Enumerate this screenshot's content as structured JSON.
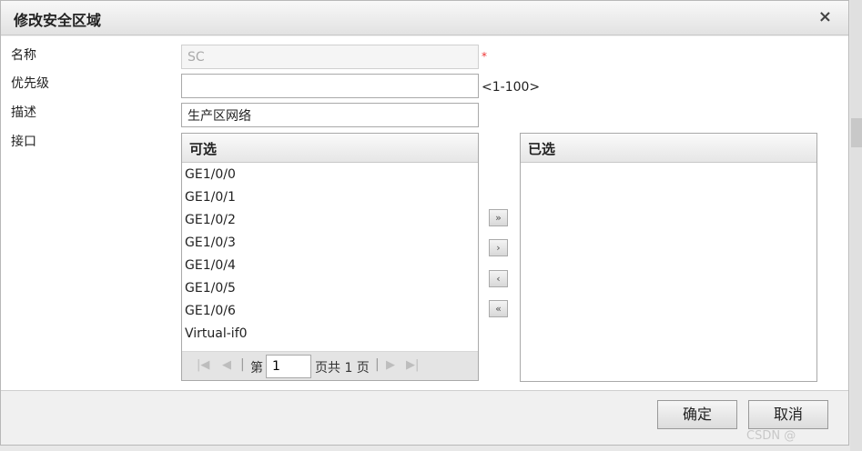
{
  "dialog": {
    "title": "修改安全区域",
    "close_glyph": "×"
  },
  "form": {
    "name_label": "名称",
    "name_value": "SC",
    "required_mark": "*",
    "priority_label": "优先级",
    "priority_value": "",
    "priority_hint": "<1-100>",
    "description_label": "描述",
    "description_value": "生产区网络",
    "interface_label": "接口"
  },
  "available": {
    "header": "可选",
    "items": [
      "GE1/0/0",
      "GE1/0/1",
      "GE1/0/2",
      "GE1/0/3",
      "GE1/0/4",
      "GE1/0/5",
      "GE1/0/6",
      "Virtual-if0"
    ]
  },
  "selected": {
    "header": "已选",
    "items": []
  },
  "pager": {
    "page_prefix": "第",
    "current_page": "1",
    "page_suffix": "页共 1 页",
    "first_glyph": "|◀",
    "prev_glyph": "◀",
    "next_glyph": "▶",
    "last_glyph": "▶|"
  },
  "transfer": {
    "move_all_right": "»",
    "move_right": "›",
    "move_left": "‹",
    "move_all_left": "«"
  },
  "buttons": {
    "ok": "确定",
    "cancel": "取消"
  },
  "watermark": "CSDN @"
}
